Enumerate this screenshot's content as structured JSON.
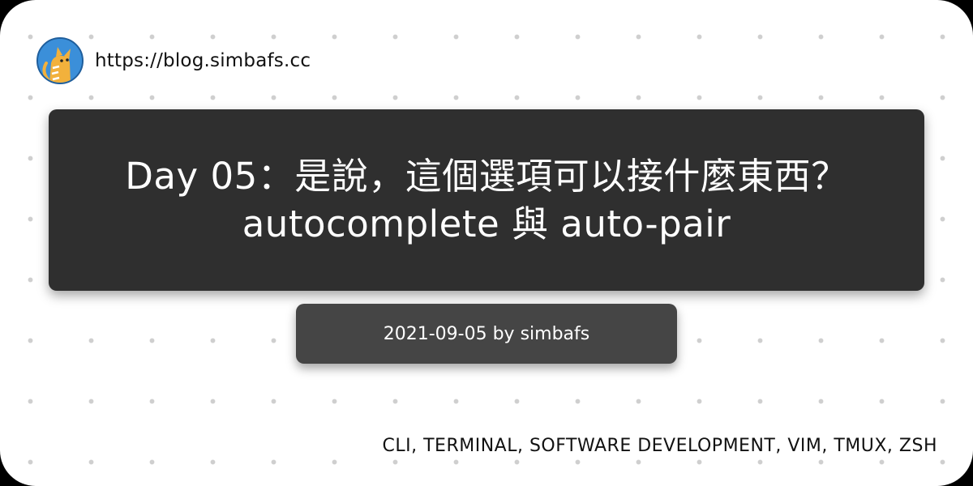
{
  "site": {
    "url": "https://blog.simbafs.cc",
    "avatar_icon": "cat-avatar-icon"
  },
  "post": {
    "title": "Day 05：是說，這個選項可以接什麼東西？autocomplete 與 auto-pair",
    "meta": "2021-09-05 by simbafs",
    "tags": "CLI, TERMINAL, SOFTWARE DEVELOPMENT, VIM, TMUX, ZSH"
  },
  "colors": {
    "title_bg": "#2f2f2f",
    "meta_bg": "#454545",
    "avatar_bg": "#3b8fd9",
    "cat": "#f2b13c"
  }
}
